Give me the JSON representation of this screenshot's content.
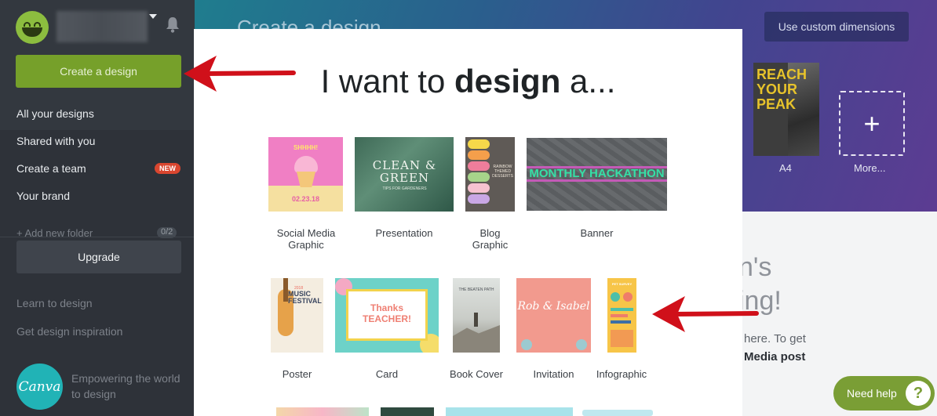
{
  "sidebar": {
    "create_button": "Create a design",
    "nav": [
      {
        "label": "All your designs",
        "badge": ""
      },
      {
        "label": "Shared with you",
        "badge": ""
      },
      {
        "label": "Create a team",
        "badge": "NEW"
      },
      {
        "label": "Your brand",
        "badge": ""
      }
    ],
    "add_folder": "+ Add new folder",
    "folder_count": "0/2",
    "upgrade_button": "Upgrade",
    "learn_link": "Learn to design",
    "inspiration_link": "Get design inspiration",
    "logo_text": "Canva",
    "tagline": "Empowering the world to design"
  },
  "main": {
    "hero_title": "Create a design",
    "custom_dimensions_button": "Use custom dimensions",
    "a4_label": "A4",
    "a4_card_text": "REACH YOUR PEAK",
    "more_label": "More...",
    "bg_fragment_1": "n's",
    "bg_fragment_2": "ing!",
    "bg_fragment_3": "here. To get",
    "bg_fragment_4": "Media post",
    "help_button": "Need help",
    "help_icon": "?"
  },
  "modal": {
    "title_prefix": "I want to ",
    "title_bold": "design",
    "title_suffix": " a...",
    "row1": [
      {
        "label": "Social Media Graphic",
        "thumb_text": "SHHHH!",
        "thumb_date": "02.23.18"
      },
      {
        "label": "Presentation",
        "thumb_text": "CLEAN & GREEN",
        "thumb_sub": "TIPS FOR GARDENERS"
      },
      {
        "label": "Blog Graphic",
        "thumb_text": "RAINBOW THEMED DESSERTS"
      },
      {
        "label": "Banner",
        "thumb_text": "MONTHLY HACKATHON"
      }
    ],
    "row2": [
      {
        "label": "Poster",
        "thumb_text": "MUSIC FESTIVAL",
        "thumb_year": "2018"
      },
      {
        "label": "Card",
        "thumb_text": "Thanks TEACHER!"
      },
      {
        "label": "Book Cover",
        "thumb_text": "THE BEATEN PATH"
      },
      {
        "label": "Invitation",
        "thumb_text": "Rob & Isabel"
      },
      {
        "label": "Infographic",
        "thumb_text": "PET SURVEY"
      }
    ]
  },
  "colors": {
    "sidebar_bg": "#2e3239",
    "create_green": "#76a02a",
    "arrow_red": "#d0101a",
    "banner_green": "#35e0a6",
    "badge_red": "#d9462f"
  },
  "icons": [
    "bell-icon",
    "caret-down-icon",
    "plus-icon",
    "question-icon",
    "arrow-icon"
  ]
}
